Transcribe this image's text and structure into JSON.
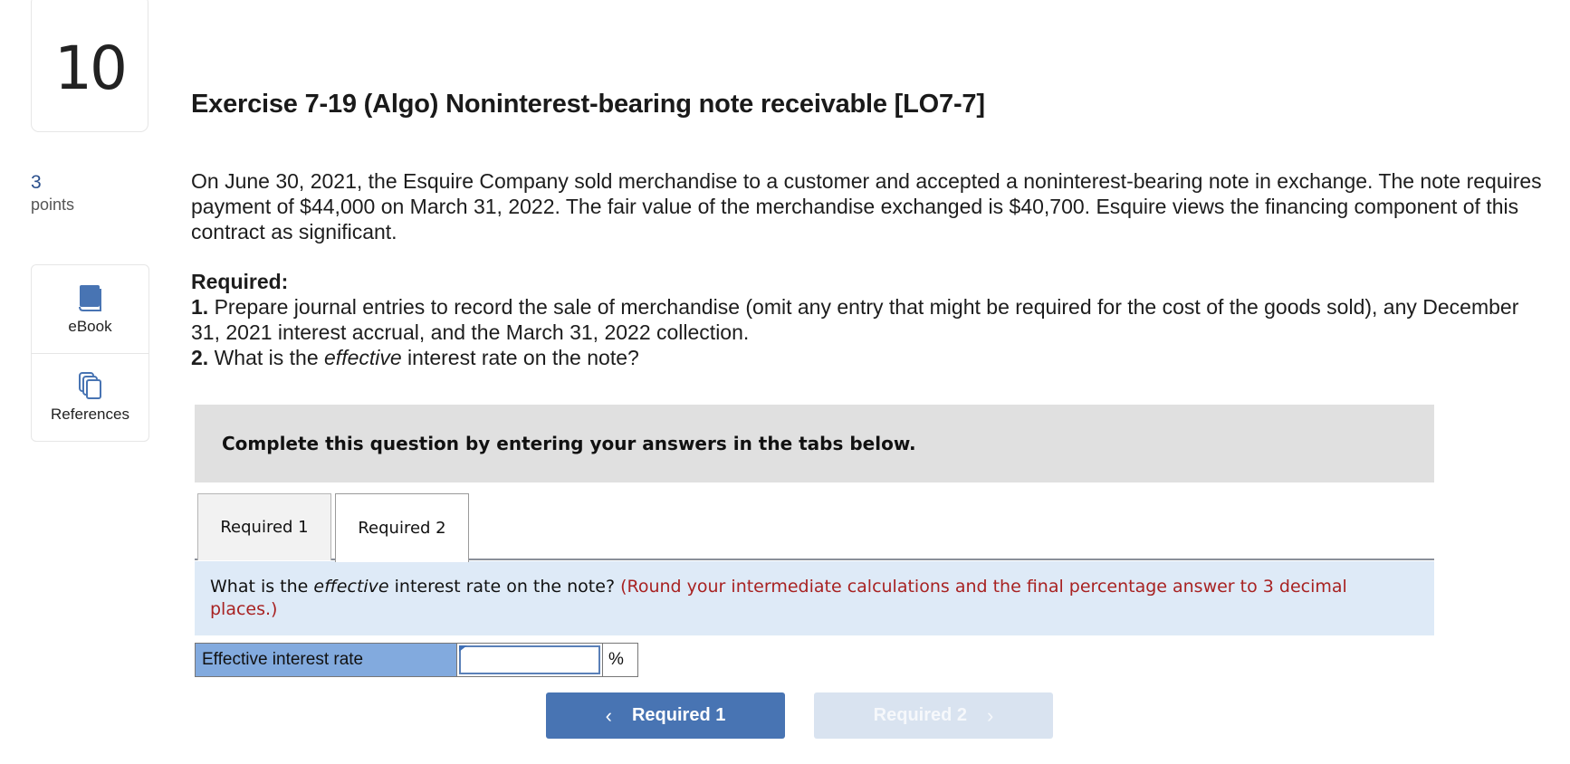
{
  "question": {
    "number": "10",
    "points_value": "3",
    "points_label": "points"
  },
  "tools": [
    {
      "label": "eBook",
      "icon": "book-icon"
    },
    {
      "label": "References",
      "icon": "documents-icon"
    }
  ],
  "title": "Exercise 7-19 (Algo) Noninterest-bearing note receivable [LO7-7]",
  "problem_text": "On June 30, 2021, the Esquire Company sold merchandise to a customer and accepted a noninterest-bearing note in exchange. The note requires payment of $44,000 on March 31, 2022. The fair value of the merchandise exchanged is $40,700. Esquire views the financing component of this contract as significant.",
  "required": {
    "heading": "Required:",
    "items": [
      {
        "num": "1.",
        "text_before": " Prepare journal entries to record the sale of merchandise (omit any entry that might be required for the cost of the goods sold), any December 31, 2021 interest accrual, and the March 31, 2022 collection.",
        "italic": "",
        "text_after": ""
      },
      {
        "num": "2.",
        "text_before": " What is the ",
        "italic": "effective",
        "text_after": " interest rate on the note?"
      }
    ]
  },
  "banner": "Complete this question by entering your answers in the tabs below.",
  "tabs": [
    {
      "label": "Required 1",
      "active": false
    },
    {
      "label": "Required 2",
      "active": true
    }
  ],
  "instruction": {
    "before": "What is the ",
    "italic": "effective",
    "after": " interest rate on the note? ",
    "note": "(Round your intermediate calculations and the final percentage answer to 3 decimal places.)"
  },
  "answer": {
    "label": "Effective interest rate",
    "value": "",
    "unit": "%"
  },
  "nav": {
    "prev_label": "Required 1",
    "next_label": "Required 2",
    "prev_chevron": "‹",
    "next_chevron": "›",
    "next_enabled": false
  },
  "colors": {
    "accent": "#4874b3",
    "note_red": "#a82222",
    "instruction_bg": "#deeaf7",
    "label_cell_bg": "#82aade"
  }
}
